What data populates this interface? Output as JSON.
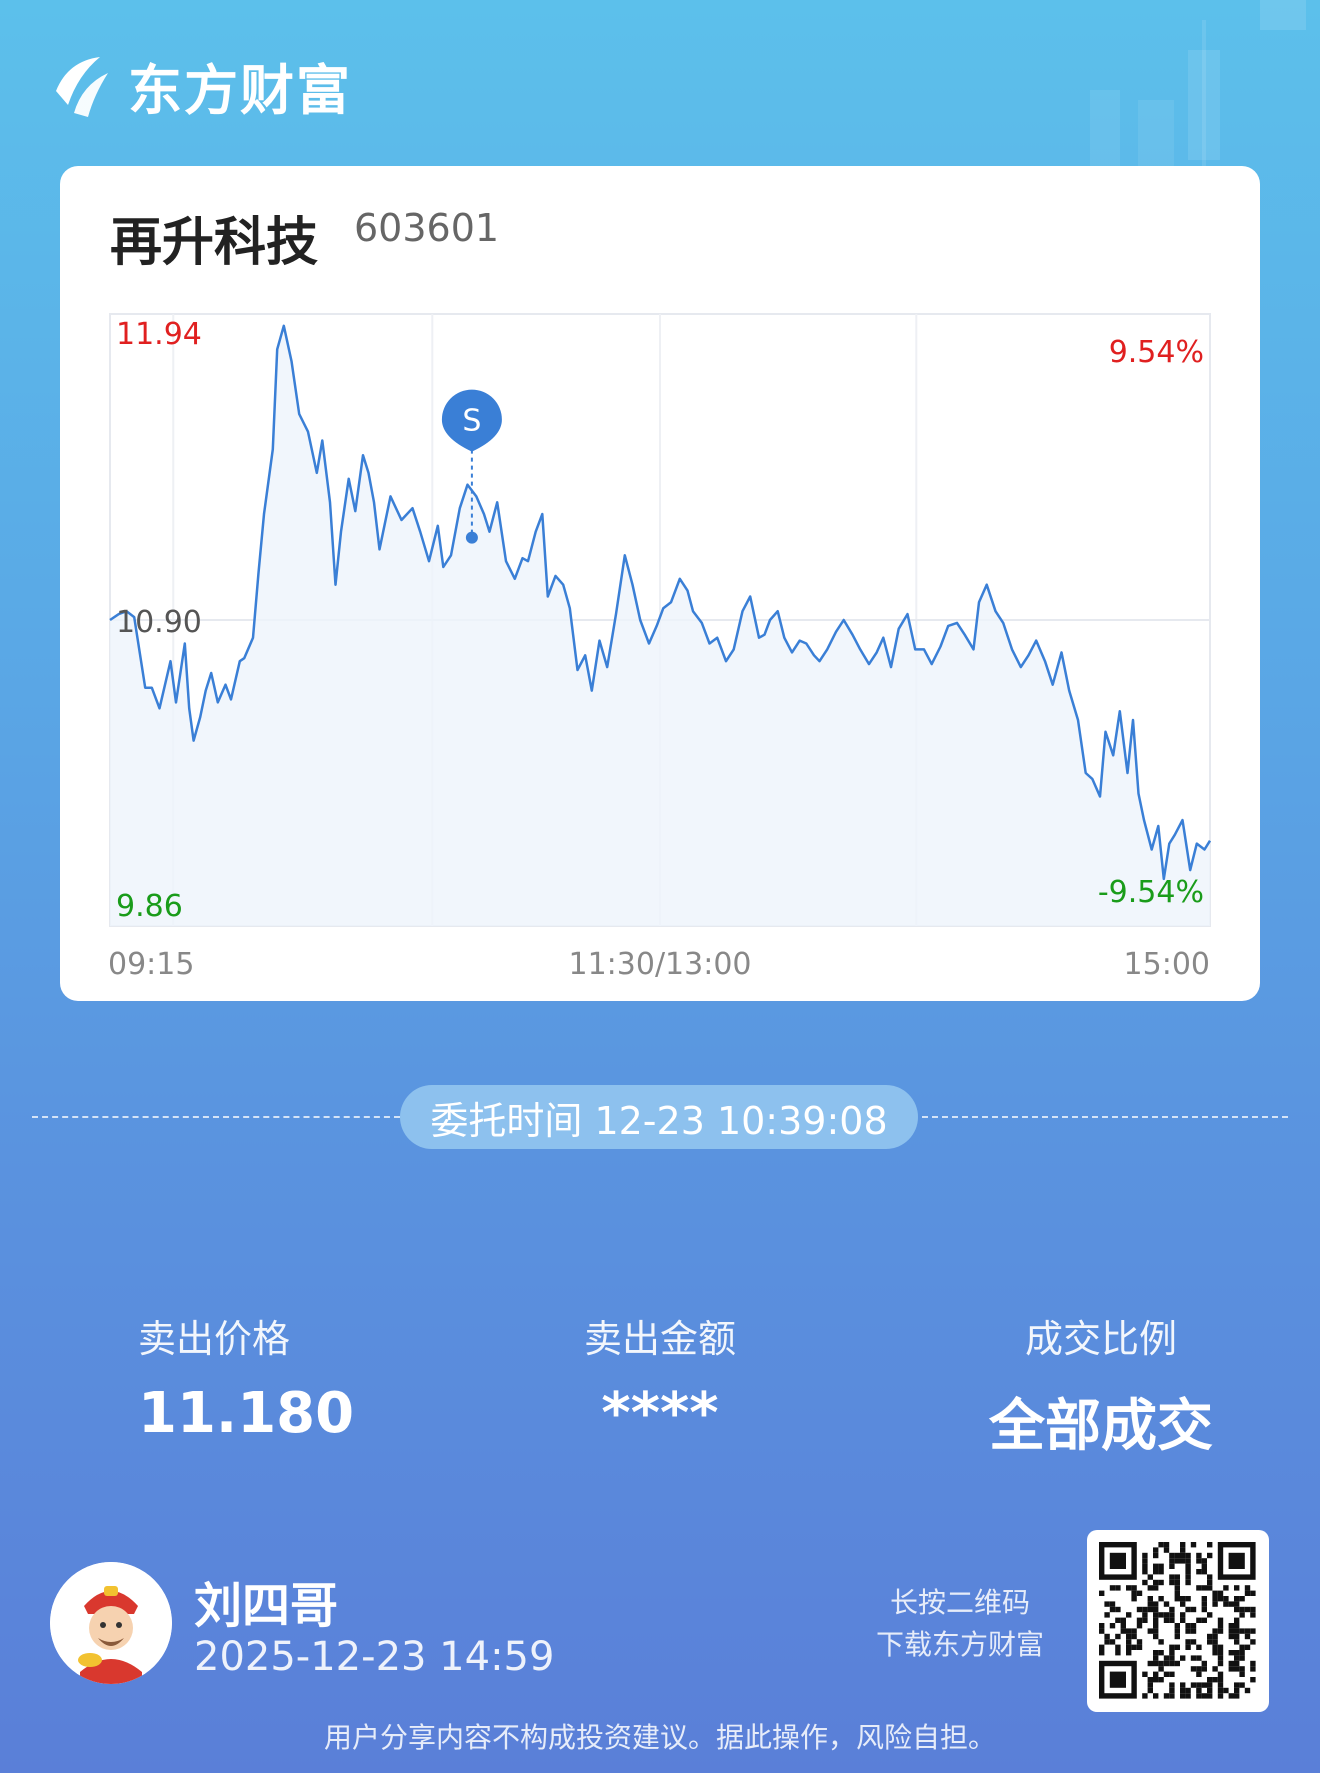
{
  "brand": {
    "name": "东方财富",
    "logo_icon": "eastmoney-logo-icon"
  },
  "stock": {
    "name": "再升科技",
    "code": "603601"
  },
  "chart_data": {
    "type": "line",
    "title": "",
    "ylim": [
      9.86,
      11.94
    ],
    "y_reference": 10.9,
    "y_tick_labels": {
      "top": "11.94",
      "mid": "10.90",
      "bottom": "9.86"
    },
    "pct_labels": {
      "top": "9.54%",
      "bottom": "-9.54%"
    },
    "x_tick_labels": {
      "start": "09:15",
      "mid": "11:30/13:00",
      "end": "15:00"
    },
    "x_range": [
      0,
      1
    ],
    "series": [
      {
        "x": [
          0,
          0.008,
          0.015,
          0.022,
          0.032,
          0.038,
          0.045,
          0.055,
          0.06,
          0.068,
          0.072,
          0.076,
          0.082,
          0.087,
          0.092,
          0.098,
          0.105,
          0.11,
          0.118,
          0.122,
          0.13,
          0.135,
          0.14,
          0.148,
          0.152,
          0.158,
          0.165,
          0.172,
          0.18,
          0.188,
          0.193,
          0.2,
          0.205,
          0.21,
          0.217,
          0.223,
          0.23,
          0.235,
          0.24,
          0.245,
          0.255,
          0.265,
          0.275,
          0.282,
          0.29,
          0.298,
          0.303,
          0.31,
          0.318,
          0.325,
          0.333,
          0.34,
          0.345,
          0.352,
          0.36,
          0.368,
          0.375,
          0.38,
          0.387,
          0.393,
          0.398,
          0.405,
          0.412,
          0.418,
          0.425,
          0.432,
          0.438,
          0.445,
          0.452,
          0.46,
          0.468,
          0.475,
          0.482,
          0.49,
          0.497,
          0.503,
          0.51,
          0.518,
          0.525,
          0.53,
          0.538,
          0.545,
          0.552,
          0.56,
          0.567,
          0.575,
          0.582,
          0.59,
          0.595,
          0.6,
          0.607,
          0.613,
          0.62,
          0.627,
          0.633,
          0.64,
          0.645,
          0.652,
          0.66,
          0.667,
          0.675,
          0.682,
          0.69,
          0.697,
          0.703,
          0.71,
          0.717,
          0.725,
          0.732,
          0.74,
          0.747,
          0.755,
          0.762,
          0.77,
          0.777,
          0.785,
          0.79,
          0.797,
          0.805,
          0.812,
          0.82,
          0.828,
          0.835,
          0.842,
          0.85,
          0.857,
          0.865,
          0.872,
          0.88,
          0.887,
          0.893,
          0.9,
          0.905,
          0.912,
          0.918,
          0.925,
          0.93,
          0.935,
          0.94,
          0.947,
          0.953,
          0.958,
          0.963,
          0.968,
          0.975,
          0.982,
          0.988,
          0.995,
          1.0
        ],
        "y": [
          10.9,
          10.92,
          10.93,
          10.91,
          10.67,
          10.67,
          10.6,
          10.76,
          10.62,
          10.82,
          10.6,
          10.49,
          10.57,
          10.66,
          10.72,
          10.62,
          10.68,
          10.63,
          10.76,
          10.77,
          10.84,
          11.06,
          11.26,
          11.48,
          11.82,
          11.9,
          11.78,
          11.6,
          11.54,
          11.4,
          11.51,
          11.3,
          11.02,
          11.2,
          11.38,
          11.27,
          11.46,
          11.4,
          11.3,
          11.14,
          11.32,
          11.24,
          11.28,
          11.2,
          11.1,
          11.22,
          11.08,
          11.12,
          11.28,
          11.36,
          11.32,
          11.26,
          11.2,
          11.3,
          11.1,
          11.04,
          11.11,
          11.1,
          11.2,
          11.26,
          10.98,
          11.05,
          11.02,
          10.94,
          10.73,
          10.78,
          10.66,
          10.83,
          10.74,
          10.92,
          11.12,
          11.02,
          10.9,
          10.82,
          10.88,
          10.94,
          10.96,
          11.04,
          11.0,
          10.93,
          10.89,
          10.82,
          10.84,
          10.76,
          10.8,
          10.93,
          10.98,
          10.84,
          10.85,
          10.9,
          10.93,
          10.84,
          10.79,
          10.83,
          10.82,
          10.78,
          10.76,
          10.8,
          10.86,
          10.9,
          10.85,
          10.8,
          10.75,
          10.79,
          10.84,
          10.74,
          10.87,
          10.92,
          10.8,
          10.8,
          10.75,
          10.81,
          10.88,
          10.89,
          10.85,
          10.8,
          10.96,
          11.02,
          10.93,
          10.89,
          10.8,
          10.74,
          10.78,
          10.83,
          10.76,
          10.68,
          10.79,
          10.66,
          10.56,
          10.38,
          10.36,
          10.3,
          10.52,
          10.44,
          10.59,
          10.38,
          10.56,
          10.31,
          10.22,
          10.12,
          10.2,
          10.02,
          10.14,
          10.17,
          10.22,
          10.05,
          10.14,
          10.12,
          10.15
        ],
        "color": "#3a7fd6"
      }
    ],
    "marker": {
      "label": "S",
      "x": 0.329,
      "y": 11.18,
      "color": "#3a7fd6"
    }
  },
  "order": {
    "time_label": "委托时间 12-23 10:39:08"
  },
  "stats": [
    {
      "label": "卖出价格",
      "value": "11.180"
    },
    {
      "label": "卖出金额",
      "value": "****"
    },
    {
      "label": "成交比例",
      "value": "全部成交"
    }
  ],
  "user": {
    "name": "刘四哥",
    "time": "2025-12-23 14:59",
    "avatar_icon": "cartoon-avatar-icon"
  },
  "qr": {
    "hint_line1": "长按二维码",
    "hint_line2": "下载东方财富",
    "icon": "qr-code-icon"
  },
  "disclaimer": "用户分享内容不构成投资建议。据此操作，风险自担。",
  "colors": {
    "up": "#e02020",
    "down": "#1a9c1a",
    "line": "#3a7fd6"
  }
}
